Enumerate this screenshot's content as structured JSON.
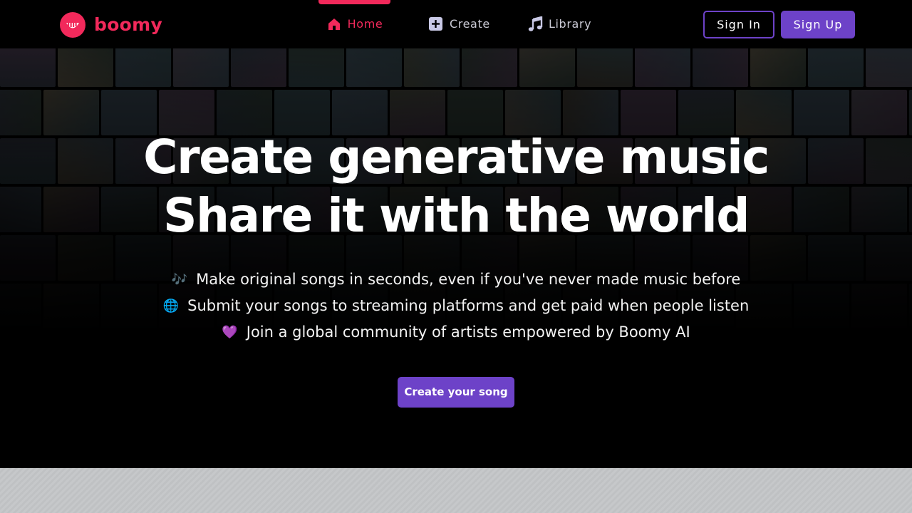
{
  "brand": {
    "name": "boomy",
    "logo_icon": "boomy-logo-icon",
    "accent_color": "#f2295b"
  },
  "nav": {
    "items": [
      {
        "label": "Home",
        "icon": "home-icon",
        "active": true
      },
      {
        "label": "Create",
        "icon": "plus-square-icon",
        "active": false
      },
      {
        "label": "Library",
        "icon": "music-note-icon",
        "active": false
      }
    ]
  },
  "auth": {
    "sign_in_label": "Sign In",
    "sign_up_label": "Sign Up",
    "button_color": "#6d42c8"
  },
  "hero": {
    "headline_line1": "Create generative music",
    "headline_line2": "Share it with the world",
    "features": [
      {
        "emoji": "🎶",
        "text": "Make original songs in seconds, even if you've never made music before"
      },
      {
        "emoji": "🌐",
        "text": "Submit your songs to streaming platforms and get paid when people listen"
      },
      {
        "emoji": "💜",
        "text": "Join a global community of artists empowered by Boomy AI"
      }
    ],
    "cta_label": "Create your song"
  }
}
